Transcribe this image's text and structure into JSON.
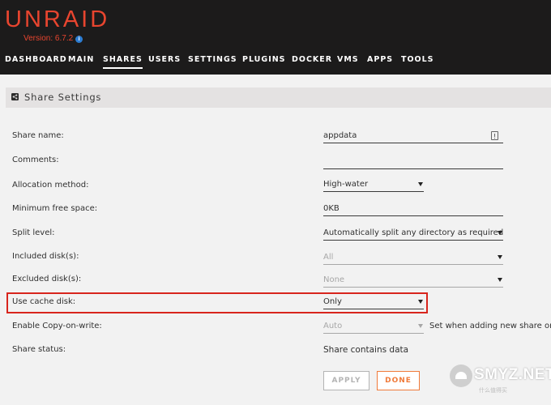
{
  "header": {
    "logo": "UNRAID",
    "version": "Version: 6.7.2",
    "info_icon_glyph": "i",
    "nav": [
      {
        "label": "DASHBOARD",
        "active": false
      },
      {
        "label": "MAIN",
        "active": false
      },
      {
        "label": "SHARES",
        "active": true
      },
      {
        "label": "USERS",
        "active": false
      },
      {
        "label": "SETTINGS",
        "active": false
      },
      {
        "label": "PLUGINS",
        "active": false
      },
      {
        "label": "DOCKER",
        "active": false
      },
      {
        "label": "VMS",
        "active": false
      },
      {
        "label": "APPS",
        "active": false
      },
      {
        "label": "TOOLS",
        "active": false
      }
    ]
  },
  "section": {
    "title": "Share Settings",
    "icon": "share-icon"
  },
  "form": {
    "share_name": {
      "label": "Share name:",
      "value": "appdata"
    },
    "comments": {
      "label": "Comments:",
      "value": ""
    },
    "allocation_method": {
      "label": "Allocation method:",
      "value": "High-water"
    },
    "min_free_space": {
      "label": "Minimum free space:",
      "value": "0KB"
    },
    "split_level": {
      "label": "Split level:",
      "value": "Automatically split any directory as required"
    },
    "included_disks": {
      "label": "Included disk(s):",
      "value": "All"
    },
    "excluded_disks": {
      "label": "Excluded disk(s):",
      "value": "None"
    },
    "use_cache_disk": {
      "label": "Use cache disk:",
      "value": "Only"
    },
    "copy_on_write": {
      "label": "Enable Copy-on-write:",
      "value": "Auto",
      "note": "Set when adding new share only."
    },
    "share_status": {
      "label": "Share status:",
      "value": "Share contains data"
    }
  },
  "buttons": {
    "apply": "APPLY",
    "done": "DONE"
  },
  "watermark": {
    "text": "SMYZ.NET",
    "sub": "什么值得买"
  },
  "colors": {
    "header_bg": "#1c1b1b",
    "brand": "#e8452f",
    "highlight_border": "#d8251d",
    "done_accent": "#f07a3a"
  }
}
